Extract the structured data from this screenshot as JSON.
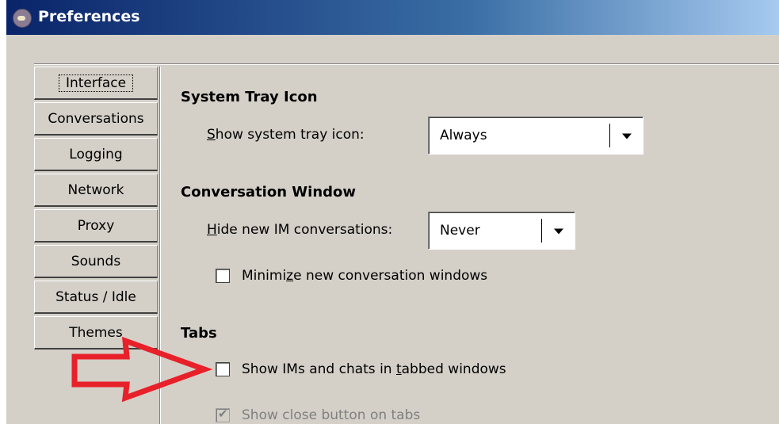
{
  "window": {
    "title": "Preferences",
    "icon": "pidgin-app-icon"
  },
  "tabs": [
    {
      "label": "Interface",
      "selected": true
    },
    {
      "label": "Conversations",
      "selected": false
    },
    {
      "label": "Logging",
      "selected": false
    },
    {
      "label": "Network",
      "selected": false
    },
    {
      "label": "Proxy",
      "selected": false
    },
    {
      "label": "Sounds",
      "selected": false
    },
    {
      "label": "Status / Idle",
      "selected": false
    },
    {
      "label": "Themes",
      "selected": false
    }
  ],
  "system_tray": {
    "heading": "System Tray Icon",
    "label_mnemonic": "S",
    "label_rest": "how system tray icon:",
    "value": "Always"
  },
  "conversation_window": {
    "heading": "Conversation Window",
    "hide_label_mnemonic": "H",
    "hide_label_rest": "ide new IM conversations:",
    "hide_value": "Never",
    "minimize_pre": "Minimi",
    "minimize_mnemonic": "z",
    "minimize_post": "e new conversation windows",
    "minimize_checked": false
  },
  "tabs_section": {
    "heading": "Tabs",
    "tabbed_pre": "Show IMs and chats in ",
    "tabbed_mnemonic": "t",
    "tabbed_post": "abbed windows",
    "tabbed_checked": false,
    "close_button_label": "Show close button on tabs",
    "close_button_checked": true,
    "close_button_enabled": false
  },
  "annotation": {
    "shape": "red-outline-arrow",
    "color": "#e8202a",
    "points_to": "tabbed-windows-checkbox"
  }
}
